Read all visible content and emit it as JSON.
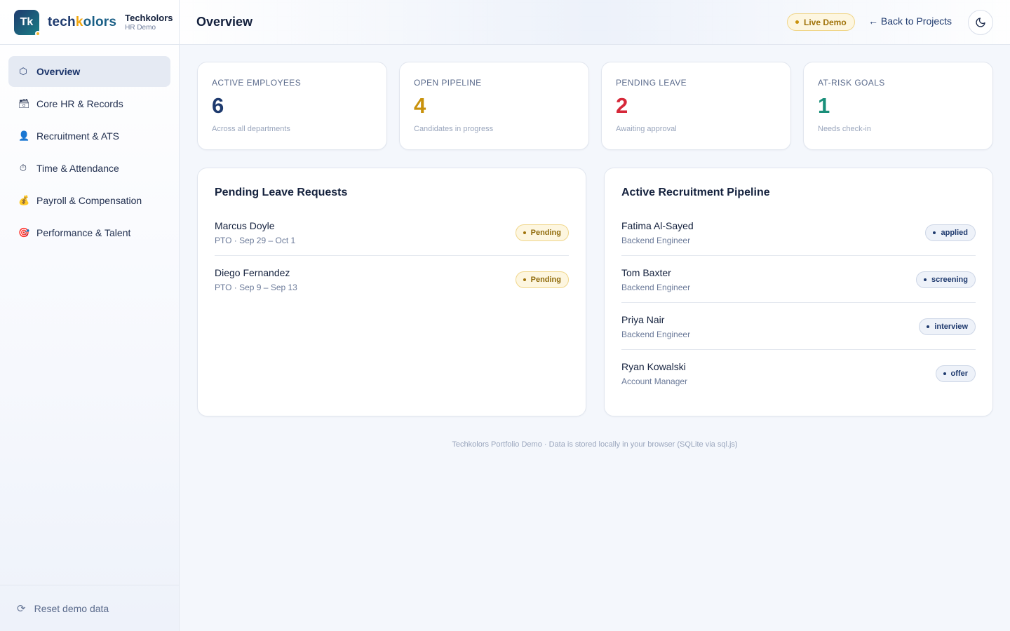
{
  "brand": {
    "logo_initials": "Tk",
    "wordmark_a": "tech",
    "wordmark_b": "k",
    "wordmark_c": "olors",
    "title": "Techkolors",
    "subtitle": "HR Demo"
  },
  "sidebar": {
    "items": [
      {
        "label": "Overview",
        "icon": "overview-icon",
        "glyph": "⬡"
      },
      {
        "label": "Core HR & Records",
        "icon": "records-icon",
        "glyph": "🗃"
      },
      {
        "label": "Recruitment & ATS",
        "icon": "recruiter-icon",
        "glyph": "👤"
      },
      {
        "label": "Time & Attendance",
        "icon": "stopwatch-icon",
        "glyph": "⏱"
      },
      {
        "label": "Payroll & Compensation",
        "icon": "money-bag-icon",
        "glyph": "💰"
      },
      {
        "label": "Performance & Talent",
        "icon": "target-icon",
        "glyph": "🎯"
      }
    ],
    "reset_label": "Reset demo data"
  },
  "header": {
    "title": "Overview",
    "live_badge": "Live Demo",
    "back_link": "← Back to Projects"
  },
  "stats": [
    {
      "label": "ACTIVE EMPLOYEES",
      "value": "6",
      "sub": "Across all departments",
      "color": "#1e3a6e"
    },
    {
      "label": "OPEN PIPELINE",
      "value": "4",
      "sub": "Candidates in progress",
      "color": "#c9920c"
    },
    {
      "label": "PENDING LEAVE",
      "value": "2",
      "sub": "Awaiting approval",
      "color": "#d62839"
    },
    {
      "label": "AT-RISK GOALS",
      "value": "1",
      "sub": "Needs check-in",
      "color": "#1a8f7a"
    }
  ],
  "leave_panel": {
    "title": "Pending Leave Requests",
    "rows": [
      {
        "name": "Marcus Doyle",
        "detail": "PTO · Sep 29 – Oct 1",
        "status": "Pending"
      },
      {
        "name": "Diego Fernandez",
        "detail": "PTO · Sep 9 – Sep 13",
        "status": "Pending"
      }
    ]
  },
  "pipeline_panel": {
    "title": "Active Recruitment Pipeline",
    "rows": [
      {
        "name": "Fatima Al-Sayed",
        "role": "Backend Engineer",
        "stage": "applied"
      },
      {
        "name": "Tom Baxter",
        "role": "Backend Engineer",
        "stage": "screening"
      },
      {
        "name": "Priya Nair",
        "role": "Backend Engineer",
        "stage": "interview"
      },
      {
        "name": "Ryan Kowalski",
        "role": "Account Manager",
        "stage": "offer"
      }
    ]
  },
  "footer_note": "Techkolors Portfolio Demo · Data is stored locally in your browser (SQLite via sql.js)"
}
